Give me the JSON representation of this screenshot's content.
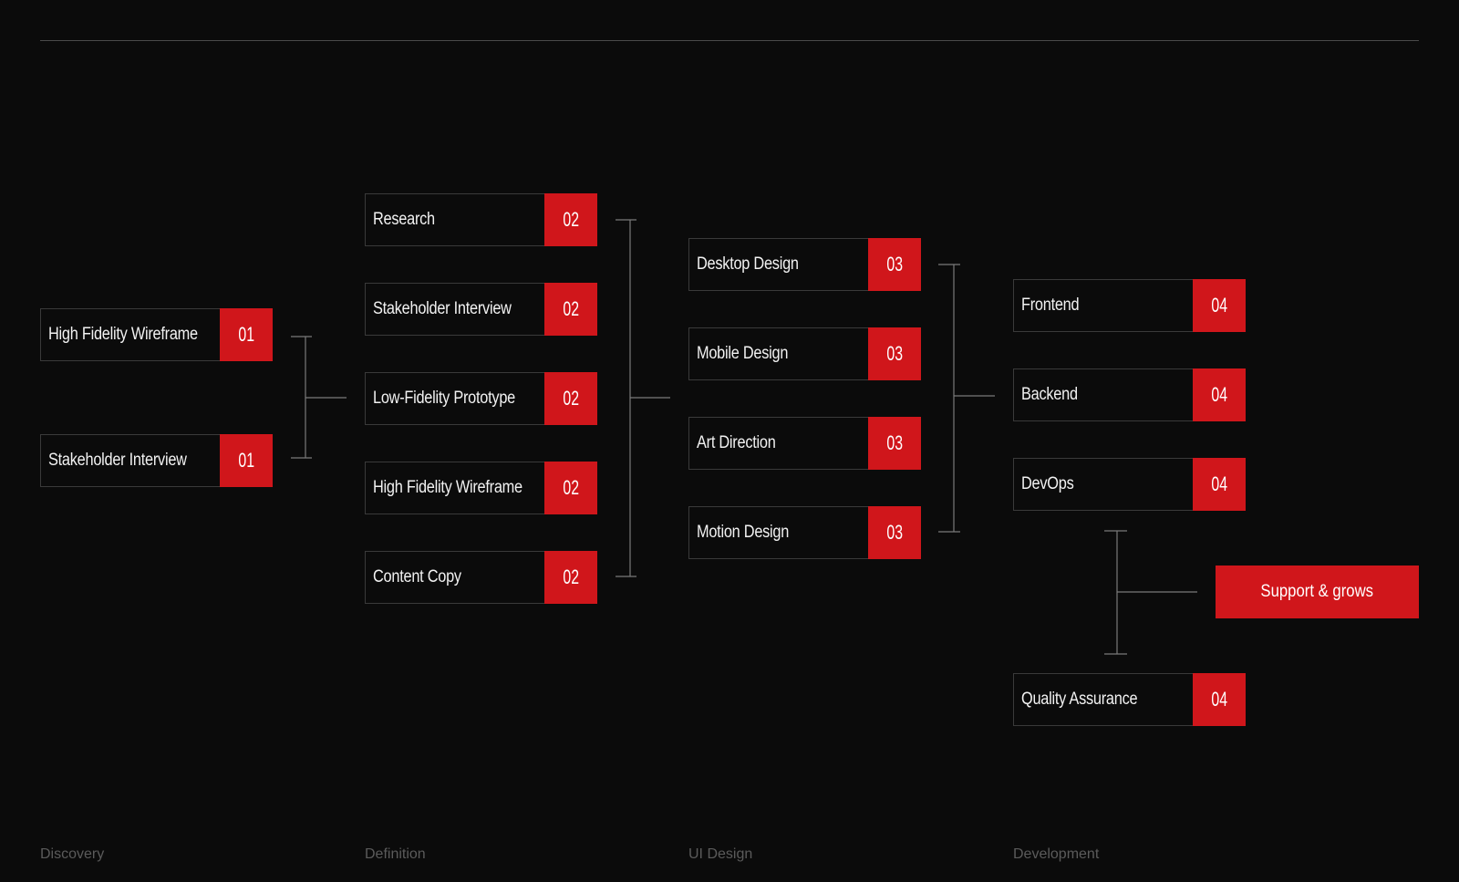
{
  "phases": [
    {
      "id": "discovery",
      "label": "Discovery"
    },
    {
      "id": "definition",
      "label": "Definition"
    },
    {
      "id": "ui-design",
      "label": "UI Design"
    },
    {
      "id": "development",
      "label": "Development"
    }
  ],
  "columns": {
    "discovery": {
      "badge": "01",
      "items": [
        "High Fidelity Wireframe",
        "Stakeholder Interview"
      ]
    },
    "definition": {
      "badge": "02",
      "items": [
        "Research",
        "Stakeholder Interview",
        "Low-Fidelity Prototype",
        "High Fidelity Wireframe",
        "Content Copy"
      ]
    },
    "ui_design": {
      "badge": "03",
      "items": [
        "Desktop Design",
        "Mobile Design",
        "Art Direction",
        "Motion Design"
      ]
    },
    "development": {
      "badge": "04",
      "items": [
        "Frontend",
        "Backend",
        "DevOps",
        "Quality Assurance"
      ]
    }
  },
  "cta": {
    "label": "Support & grows"
  },
  "colors": {
    "background": "#0b0b0b",
    "accent": "#d0161b",
    "node_border": "#3a3a3a",
    "connector": "#7a7a7a",
    "phase_label": "#5b5b5b"
  }
}
